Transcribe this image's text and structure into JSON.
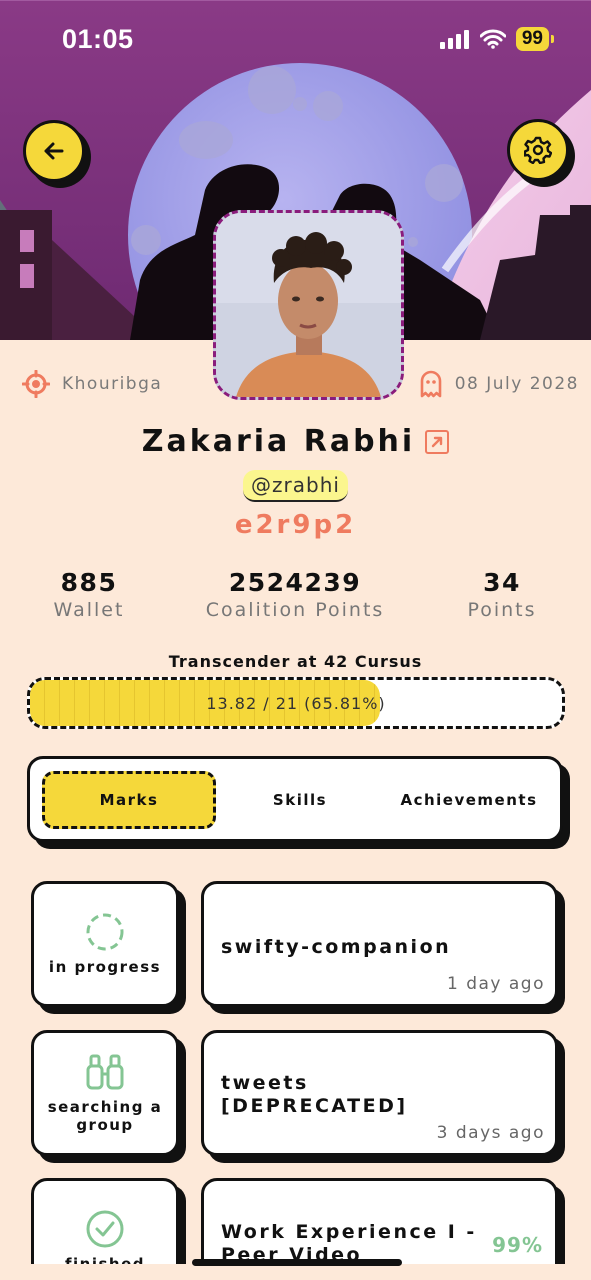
{
  "status_bar": {
    "time": "01:05",
    "battery": "99"
  },
  "profile": {
    "location": "Khouribga",
    "date": "08 July 2028",
    "name": "Zakaria Rabhi",
    "login": "@zrabhi",
    "campus_code": "e2r9p2"
  },
  "stats": [
    {
      "value": "885",
      "label": "Wallet"
    },
    {
      "value": "2524239",
      "label": "Coalition Points"
    },
    {
      "value": "34",
      "label": "Points"
    }
  ],
  "cursus": {
    "title": "Transcender at 42 Cursus",
    "progress_label": "13.82 / 21 (65.81%)",
    "progress_fraction": 0.6581
  },
  "tabs": [
    {
      "label": "Marks",
      "active": true
    },
    {
      "label": "Skills",
      "active": false
    },
    {
      "label": "Achievements",
      "active": false
    }
  ],
  "projects": [
    {
      "status": "in progress",
      "name": "swifty-companion",
      "time": "1 day ago",
      "grade": ""
    },
    {
      "status": "searching a group",
      "name": "tweets [DEPRECATED]",
      "time": "3 days ago",
      "grade": ""
    },
    {
      "status": "finished",
      "name": "Work Experience I - Peer Video",
      "time": "",
      "grade": "99%"
    }
  ],
  "icons": {
    "back": "arrow-left-icon",
    "settings": "gear-icon",
    "location": "target-icon",
    "date": "ghost-icon",
    "external": "external-link-icon",
    "in_progress": "dashed-circle-icon",
    "searching": "binoculars-icon",
    "finished": "check-circle-icon"
  },
  "colors": {
    "accent_yellow": "#f5d83a",
    "accent_orange": "#ef7b5f",
    "background": "#fde9d9",
    "success_green": "#84c593",
    "frame_purple": "#8a1c7c"
  }
}
